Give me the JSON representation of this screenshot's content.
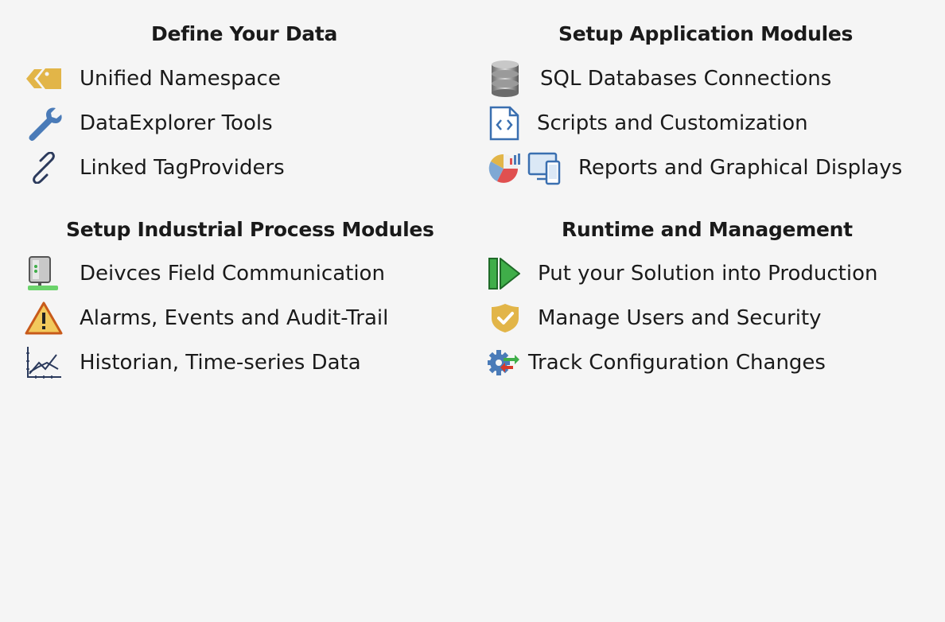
{
  "sections": [
    {
      "title": "Define Your Data",
      "items": [
        {
          "label": "Unified Namespace",
          "icon": "tag-icon"
        },
        {
          "label": "DataExplorer Tools",
          "icon": "wrench-icon"
        },
        {
          "label": "Linked TagProviders",
          "icon": "link-icon"
        }
      ]
    },
    {
      "title": "Setup Application Modules",
      "items": [
        {
          "label": "SQL Databases Connections",
          "icon": "database-icon"
        },
        {
          "label": "Scripts and Customization",
          "icon": "code-file-icon"
        },
        {
          "label": "Reports and Graphical Displays",
          "icon": "pie-chart-icon"
        }
      ]
    },
    {
      "title": "Setup Industrial Process Modules",
      "items": [
        {
          "label": "Deivces Field Communication",
          "icon": "network-device-icon"
        },
        {
          "label": "Alarms, Events and Audit-Trail",
          "icon": "warning-icon"
        },
        {
          "label": "Historian, Time-series Data",
          "icon": "trend-chart-icon"
        }
      ]
    },
    {
      "title": "Runtime and Management",
      "items": [
        {
          "label": "Put your Solution into Production",
          "icon": "play-icon"
        },
        {
          "label": "Manage Users and Security",
          "icon": "shield-check-icon"
        },
        {
          "label": "Track Configuration Changes",
          "icon": "gear-arrows-icon"
        }
      ]
    }
  ],
  "colors": {
    "background": "#f5f5f5",
    "text": "#1a1a1a",
    "icon_blue": "#4a7bb8",
    "icon_gold": "#e2b548",
    "icon_green": "#3fae49"
  }
}
